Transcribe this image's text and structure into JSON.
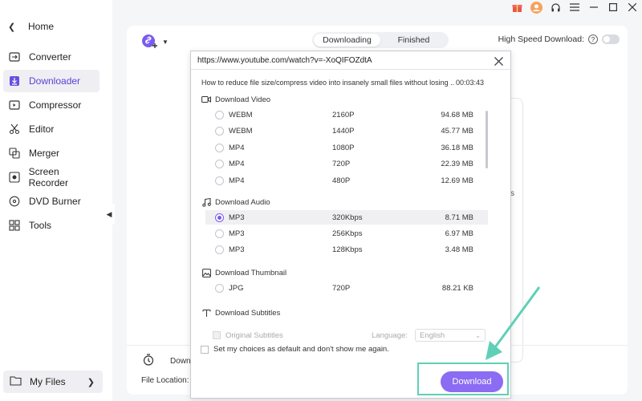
{
  "sidebar": {
    "home": "Home",
    "items": [
      {
        "label": "Converter",
        "icon": "converter-icon"
      },
      {
        "label": "Downloader",
        "icon": "downloader-icon",
        "active": true
      },
      {
        "label": "Compressor",
        "icon": "compressor-icon"
      },
      {
        "label": "Editor",
        "icon": "editor-icon"
      },
      {
        "label": "Merger",
        "icon": "merger-icon"
      },
      {
        "label": "Screen Recorder",
        "icon": "screen-recorder-icon"
      },
      {
        "label": "DVD Burner",
        "icon": "dvd-burner-icon"
      },
      {
        "label": "Tools",
        "icon": "tools-icon"
      }
    ],
    "my_files": "My Files"
  },
  "header": {
    "tabs": [
      "Downloading",
      "Finished"
    ],
    "high_speed_label": "High Speed Download:"
  },
  "background": {
    "download_partial": "Down",
    "file_location": "File Location:",
    "fragment_s": "s"
  },
  "dialog": {
    "url": "https://www.youtube.com/watch?v=-XoQIFOZdtA",
    "video_title": "How to reduce file size/compress video into insanely small files without losing ...",
    "video_duration": "00:03:43",
    "sections": {
      "video": "Download Video",
      "audio": "Download Audio",
      "thumbnail": "Download Thumbnail",
      "subtitles": "Download Subtitles"
    },
    "video_options": [
      {
        "format": "WEBM",
        "res": "2160P",
        "size": "94.68 MB"
      },
      {
        "format": "WEBM",
        "res": "1440P",
        "size": "45.77 MB"
      },
      {
        "format": "MP4",
        "res": "1080P",
        "size": "36.18 MB"
      },
      {
        "format": "MP4",
        "res": "720P",
        "size": "22.39 MB"
      },
      {
        "format": "MP4",
        "res": "480P",
        "size": "12.69 MB"
      }
    ],
    "audio_options": [
      {
        "format": "MP3",
        "res": "320Kbps",
        "size": "8.71 MB",
        "selected": true
      },
      {
        "format": "MP3",
        "res": "256Kbps",
        "size": "6.97 MB"
      },
      {
        "format": "MP3",
        "res": "128Kbps",
        "size": "3.48 MB"
      }
    ],
    "thumbnail_options": [
      {
        "format": "JPG",
        "res": "720P",
        "size": "88.21 KB"
      }
    ],
    "subtitles": {
      "original_label": "Original Subtitles",
      "language_label": "Language:",
      "language_value": "English"
    },
    "default_label": "Set my choices as default and don't show me again.",
    "download_button": "Download"
  },
  "colors": {
    "accent": "#8b6cf2",
    "highlight": "#5fd0b7"
  }
}
